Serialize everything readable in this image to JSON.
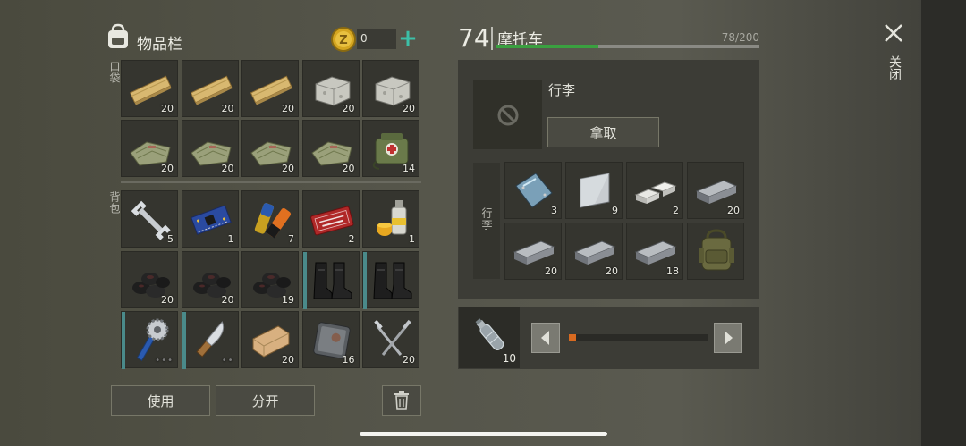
{
  "inventory": {
    "title": "物品栏",
    "coins": "0",
    "pockets_label": "口袋",
    "backpack_label": "背包",
    "use_label": "使用",
    "split_label": "分开",
    "pockets": [
      {
        "icon": "wooden-plank-icon",
        "count": "20"
      },
      {
        "icon": "wooden-plank-icon",
        "count": "20"
      },
      {
        "icon": "wooden-plank-icon",
        "count": "20"
      },
      {
        "icon": "stone-block-icon",
        "count": "20"
      },
      {
        "icon": "stone-block-icon",
        "count": "20"
      },
      {
        "icon": "cloth-icon",
        "count": "20"
      },
      {
        "icon": "cloth-icon",
        "count": "20"
      },
      {
        "icon": "cloth-icon",
        "count": "20"
      },
      {
        "icon": "cloth-icon",
        "count": "20"
      },
      {
        "icon": "first-aid-bag-icon",
        "count": "14"
      }
    ],
    "backpack": [
      {
        "icon": "wrench-icon",
        "count": "5"
      },
      {
        "icon": "circuit-board-icon",
        "count": "1"
      },
      {
        "icon": "batteries-icon",
        "count": "7"
      },
      {
        "icon": "coupon-icon",
        "count": "2"
      },
      {
        "icon": "spray-can-icon",
        "count": "1"
      },
      {
        "icon": "coal-icon",
        "count": "20"
      },
      {
        "icon": "coal-icon",
        "count": "20"
      },
      {
        "icon": "coal-icon",
        "count": "19"
      },
      {
        "icon": "boots-icon",
        "count": ""
      },
      {
        "icon": "boots-icon",
        "count": ""
      },
      {
        "icon": "saw-blade-club-icon",
        "count": "•••"
      },
      {
        "icon": "machete-icon",
        "count": "••"
      },
      {
        "icon": "wood-block-icon",
        "count": "20"
      },
      {
        "icon": "metal-plate-icon",
        "count": "16"
      },
      {
        "icon": "nails-icon",
        "count": "20"
      }
    ]
  },
  "vehicle": {
    "level": "74",
    "name": "摩托车",
    "capacity_text": "78/200",
    "capacity_fraction": 0.39,
    "capacity_color": "#3aa040",
    "luggage_title": "行李",
    "take_label": "拿取",
    "storage_label": "行李",
    "storage": [
      {
        "icon": "glass-sheet-icon",
        "count": "3"
      },
      {
        "icon": "steel-plate-icon",
        "count": "9"
      },
      {
        "icon": "silver-ingots-icon",
        "count": "2"
      },
      {
        "icon": "iron-ingot-icon",
        "count": "20"
      },
      {
        "icon": "iron-ingot-icon",
        "count": "20"
      },
      {
        "icon": "iron-ingot-icon",
        "count": "20"
      },
      {
        "icon": "iron-ingot-icon",
        "count": "18"
      },
      {
        "icon": "military-backpack-icon",
        "count": ""
      }
    ],
    "fuel_count": "10",
    "fuel_fraction": 0.05
  },
  "close_label": "关闭"
}
